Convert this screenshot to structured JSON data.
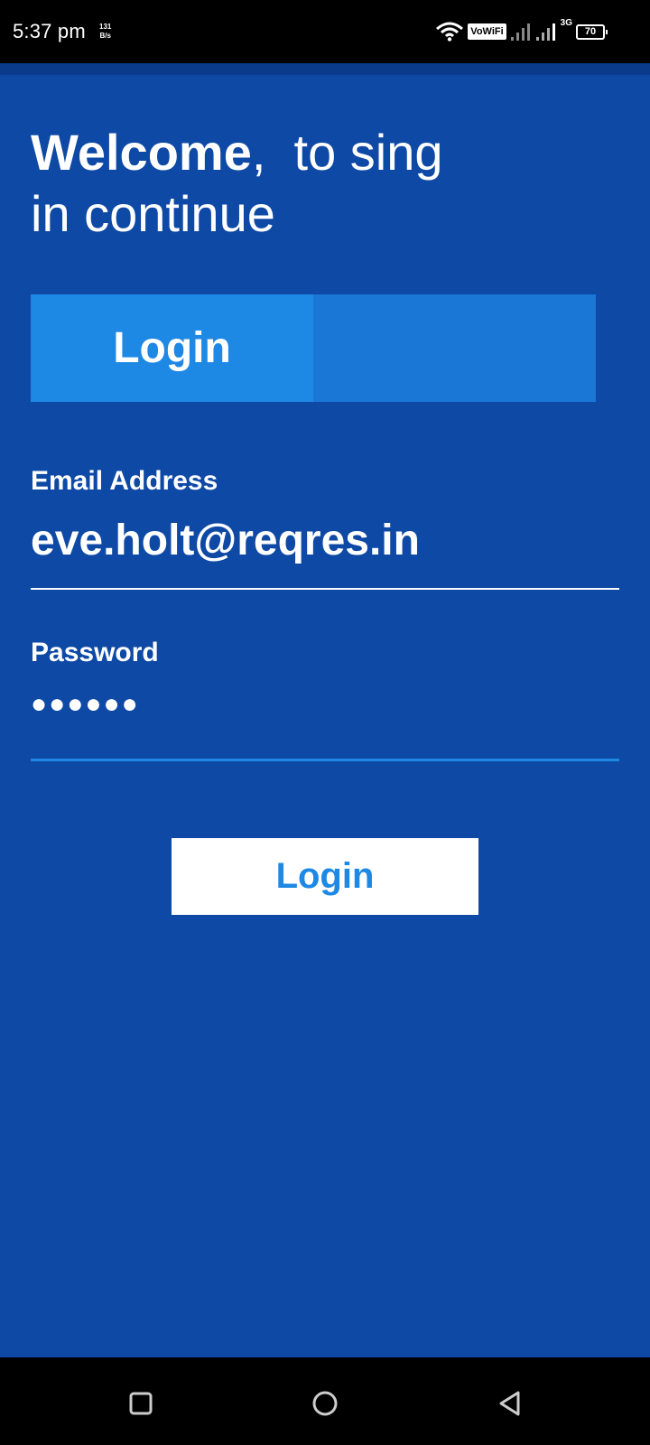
{
  "status_bar": {
    "time": "5:37 pm",
    "net_speed_value": "131",
    "net_speed_unit": "B/s",
    "vowifi": "VoWiFi",
    "network_type": "3G",
    "battery": "70"
  },
  "welcome": {
    "bold": "Welcome",
    "rest": ",  to sing",
    "line2": "in continue"
  },
  "tabs": [
    {
      "label": "Login"
    },
    {
      "label": ""
    }
  ],
  "form": {
    "email_label": "Email Address",
    "email_value": "eve.holt@reqres.in",
    "password_label": "Password",
    "password_value": "●●●●●●"
  },
  "submit": {
    "label": "Login"
  },
  "colors": {
    "background": "#0e49a5",
    "tab_active": "#1e88e5",
    "tab_inactive": "#1b77d6",
    "accent": "#1e88e5",
    "button_bg": "#ffffff"
  },
  "nav": {
    "recents_icon": "square-icon",
    "home_icon": "circle-icon",
    "back_icon": "triangle-back-icon"
  }
}
